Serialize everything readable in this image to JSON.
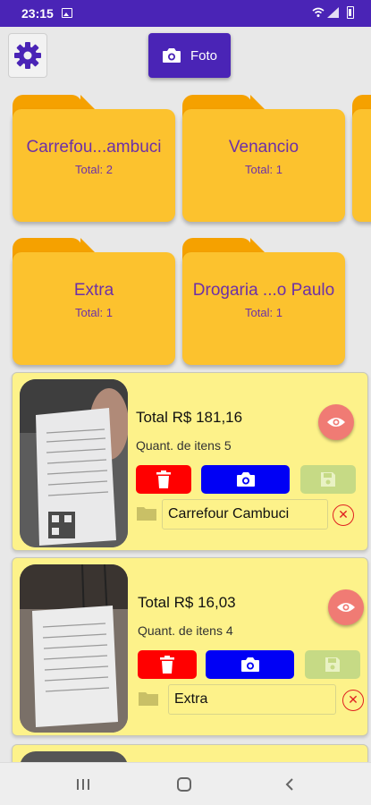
{
  "status_bar": {
    "time": "23:15"
  },
  "toolbar": {
    "photo_button_label": "Foto"
  },
  "folders": [
    {
      "name": "Carrefou...ambuci",
      "total": "Total: 2"
    },
    {
      "name": "Venancio",
      "total": "Total: 1"
    },
    {
      "name": "Extra",
      "total": "Total: 1"
    },
    {
      "name": "Drogaria ...o Paulo",
      "total": "Total: 1"
    }
  ],
  "receipts": [
    {
      "total": "Total R$ 181,16",
      "quantity": "Quant. de itens 5",
      "store": "Carrefour Cambuci"
    },
    {
      "total": "Total R$ 16,03",
      "quantity": "Quant. de itens 4",
      "store": "Extra"
    }
  ],
  "colors": {
    "status_bar": "#4a24b6",
    "primary": "#4a24b6",
    "folder": "#fcc22e",
    "folder_tab": "#f5a100",
    "folder_text": "#6d30a7",
    "receipt_card": "#fdf28a",
    "delete": "#ff0000",
    "camera": "#0000f5",
    "save_disabled": "#c6da85",
    "view": "#f07b74"
  },
  "icons": {
    "settings": "gear-icon",
    "photo": "camera-icon",
    "view": "eye-icon",
    "delete": "trash-icon",
    "retake": "camera-icon",
    "save": "save-icon",
    "folder": "folder-icon",
    "clear": "close-icon"
  }
}
